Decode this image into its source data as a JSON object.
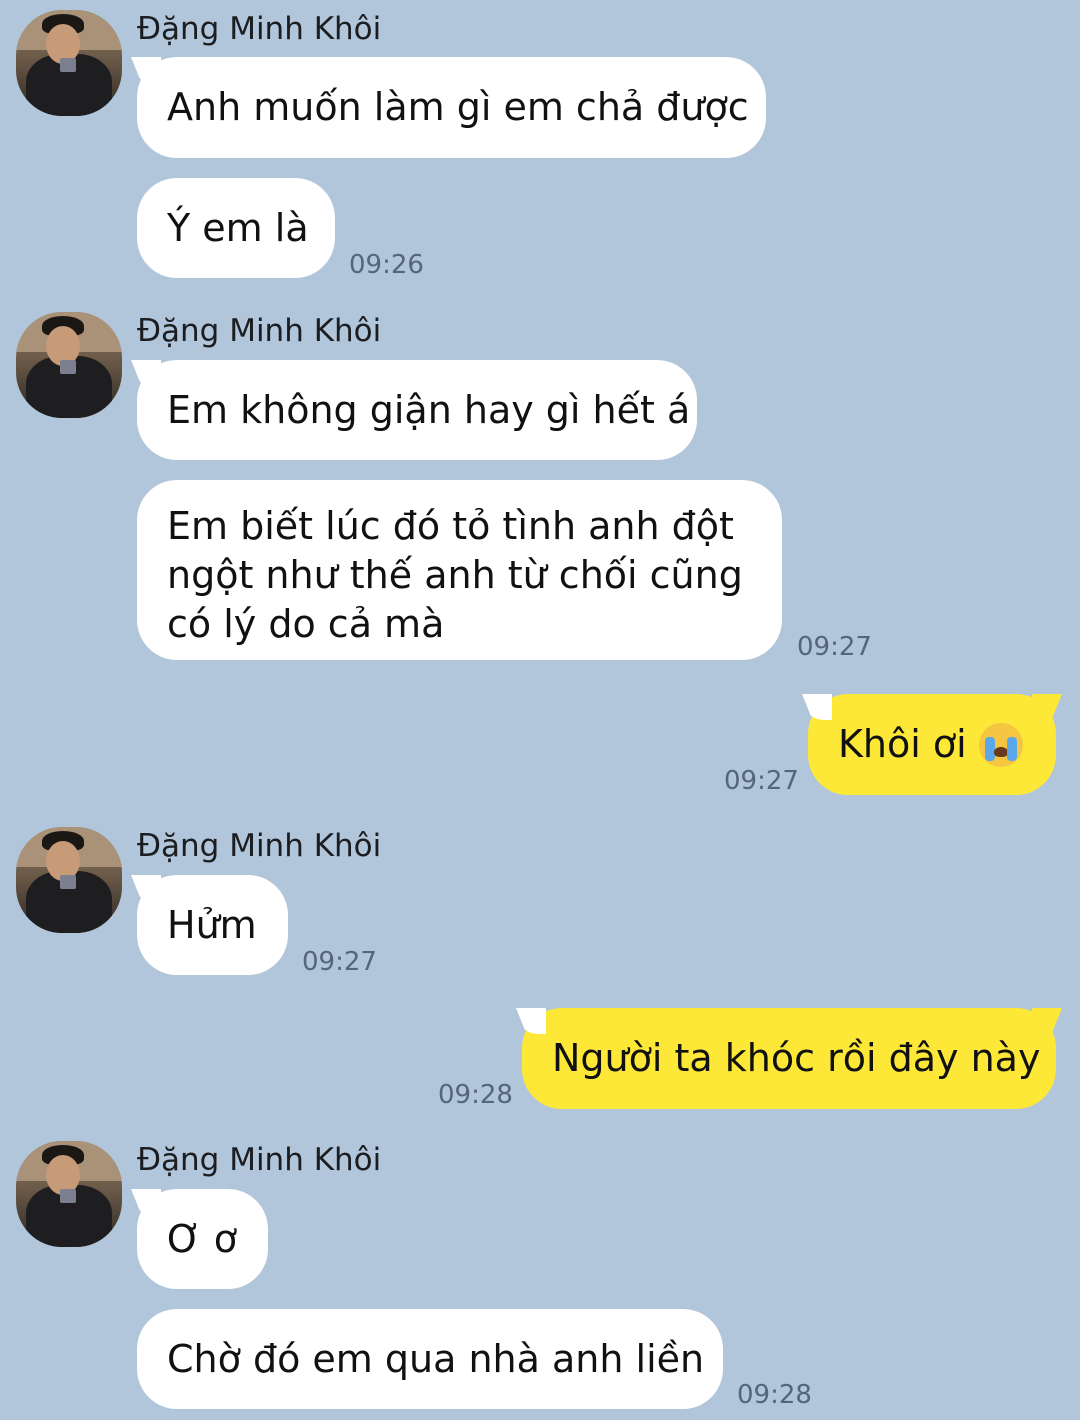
{
  "contact_name": "Đặng Minh Khôi",
  "colors": {
    "background": "#b1c6da",
    "incoming_bubble": "#ffffff",
    "outgoing_bubble": "#fde838"
  },
  "messages": [
    {
      "sender": "Đặng Minh Khôi",
      "text": "Anh muốn làm gì em chả được"
    },
    {
      "sender": "Đặng Minh Khôi",
      "text": "Ý em là",
      "time": "09:26"
    },
    {
      "sender": "Đặng Minh Khôi",
      "text": "Em không giận hay gì hết á"
    },
    {
      "sender": "Đặng Minh Khôi",
      "lines": [
        "Em biết lúc đó tỏ tình anh đột",
        "ngột như thế anh từ chối cũng",
        "có lý do cả mà"
      ],
      "time": "09:27"
    },
    {
      "sender": "me",
      "text": "Khôi ơi",
      "emoji": "loudly-crying-face",
      "time": "09:27"
    },
    {
      "sender": "Đặng Minh Khôi",
      "text": "Hửm",
      "time": "09:27"
    },
    {
      "sender": "me",
      "text": "Người ta khóc rồi đây này",
      "time": "09:28"
    },
    {
      "sender": "Đặng Minh Khôi",
      "text": "Ơ ơ"
    },
    {
      "sender": "Đặng Minh Khôi",
      "text": "Chờ đó em qua nhà anh liền",
      "time": "09:28"
    }
  ]
}
